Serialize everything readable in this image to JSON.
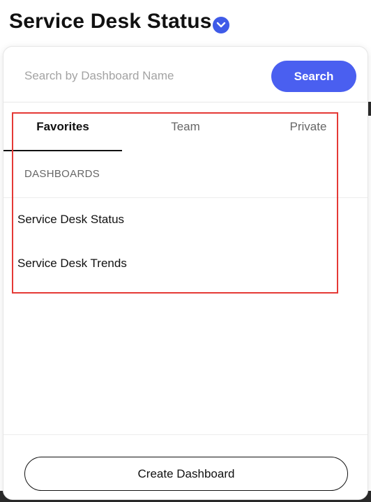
{
  "header": {
    "title": "Service Desk Status",
    "chevron_icon": "chevron-down-icon",
    "accent_color": "#3f5be8"
  },
  "search": {
    "placeholder": "Search by Dashboard Name",
    "value": "",
    "button_label": "Search"
  },
  "tabs": [
    {
      "label": "Favorites",
      "active": true
    },
    {
      "label": "Team",
      "active": false
    },
    {
      "label": "Private",
      "active": false
    }
  ],
  "dashboards": {
    "section_label": "DASHBOARDS",
    "items": [
      {
        "label": "Service Desk Status"
      },
      {
        "label": "Service Desk Trends"
      }
    ]
  },
  "footer": {
    "create_label": "Create Dashboard"
  },
  "highlight": {
    "color": "#e53935"
  }
}
